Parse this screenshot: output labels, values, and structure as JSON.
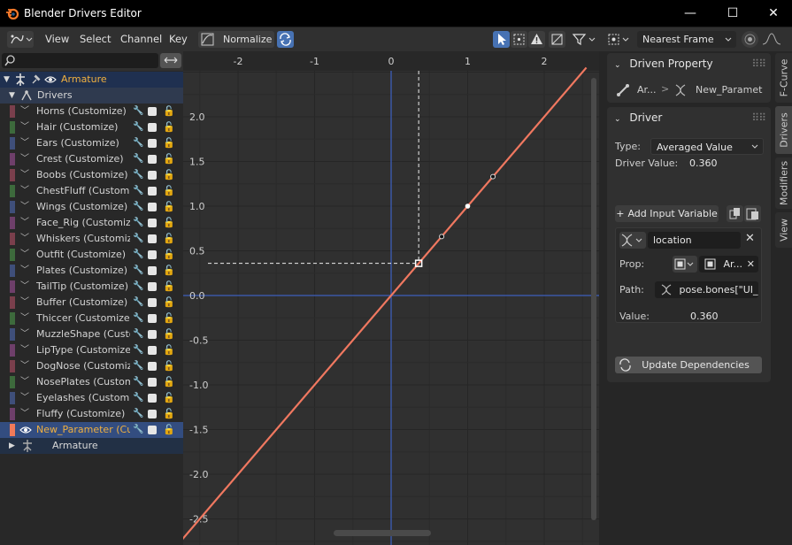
{
  "window": {
    "title": "Blender Drivers Editor",
    "minimize": "—",
    "maximize": "☐",
    "close": "✕"
  },
  "header": {
    "menus": [
      "View",
      "Select",
      "Channel",
      "Key"
    ],
    "normalize_label": "Normalize",
    "auto_snap": "Nearest Frame"
  },
  "channels": {
    "armature_label": "Armature",
    "drivers_label": "Drivers",
    "items": [
      {
        "label": "Horns (Customize)",
        "color": "#7a3f4c"
      },
      {
        "label": "Hair (Customize)",
        "color": "#3d6a3c"
      },
      {
        "label": "Ears (Customize)",
        "color": "#3f4f7a"
      },
      {
        "label": "Crest (Customize)",
        "color": "#6e3f6a"
      },
      {
        "label": "Boobs (Customize)",
        "color": "#7a3f4c"
      },
      {
        "label": "ChestFluff (Customize)",
        "color": "#3d6a3c"
      },
      {
        "label": "Wings (Customize)",
        "color": "#3f4f7a"
      },
      {
        "label": "Face_Rig (Customize)",
        "color": "#6e3f6a"
      },
      {
        "label": "Whiskers (Customize)",
        "color": "#7a3f4c"
      },
      {
        "label": "Outfit (Customize)",
        "color": "#3d6a3c"
      },
      {
        "label": "Plates (Customize)",
        "color": "#3f4f7a"
      },
      {
        "label": "TailTip (Customize)",
        "color": "#6e3f6a"
      },
      {
        "label": "Buffer (Customize)",
        "color": "#7a3f4c"
      },
      {
        "label": "Thiccer (Customize)",
        "color": "#3d6a3c"
      },
      {
        "label": "MuzzleShape (Customize)",
        "color": "#3f4f7a"
      },
      {
        "label": "LipType (Customize)",
        "color": "#6e3f6a"
      },
      {
        "label": "DogNose (Customize)",
        "color": "#7a3f4c"
      },
      {
        "label": "NosePlates (Customize)",
        "color": "#3d6a3c"
      },
      {
        "label": "Eyelashes (Customize)",
        "color": "#3f4f7a"
      },
      {
        "label": "Fluffy (Customize)",
        "color": "#6e3f6a"
      }
    ],
    "active_label": "New_Parameter (Customize)",
    "armature2_label": "Armature"
  },
  "graph": {
    "x_ticks": [
      "-2",
      "-1",
      "0",
      "1",
      "2"
    ],
    "y_ticks": [
      "2.0",
      "1.5",
      "1.0",
      "0.5",
      "0.0",
      "-0.5",
      "-1.0",
      "-1.5",
      "-2.0",
      "-2.5"
    ],
    "cursor_x": 0.36,
    "cursor_y": 0.36
  },
  "sidebar": {
    "driven_property": {
      "header": "Driven Property",
      "object": "Ar...",
      "property": "New_Paramet"
    },
    "driver": {
      "header": "Driver",
      "type_label": "Type:",
      "type_value": "Averaged Value",
      "value_label": "Driver Value:",
      "value": "0.360",
      "add_var_label": "Add Input Variable"
    },
    "variable": {
      "name": "location",
      "prop_label": "Prop:",
      "prop_value": "Ar...",
      "path_label": "Path:",
      "path_value": "pose.bones[\"UI_...",
      "value_label": "Value:",
      "value": "0.360"
    },
    "update_label": "Update Dependencies",
    "tabs": [
      "F-Curve",
      "Drivers",
      "Modifiers",
      "View"
    ]
  }
}
